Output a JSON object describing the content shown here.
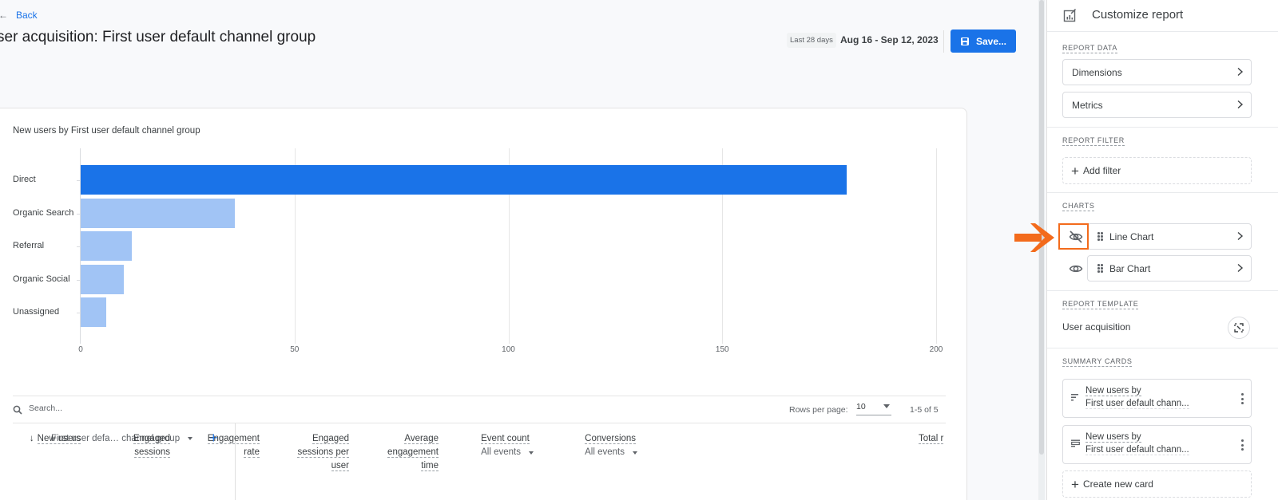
{
  "header": {
    "back_label": "Back",
    "title": "ser acquisition: First user default channel group",
    "date_chip": "Last 28 days",
    "date_range": "Aug 16 - Sep 12, 2023",
    "save_label": "Save..."
  },
  "chart_data": {
    "type": "bar",
    "orientation": "horizontal",
    "title": "New users by First user default channel group",
    "categories": [
      "Direct",
      "Organic Search",
      "Referral",
      "Organic Social",
      "Unassigned"
    ],
    "values": [
      179,
      36,
      12,
      10,
      6
    ],
    "highlighted_index": 0,
    "xlabel": "",
    "ylabel": "",
    "xlim": [
      0,
      200
    ],
    "xticks": [
      0,
      50,
      100,
      150,
      200
    ],
    "xtick_labels": [
      "0",
      "50",
      "100",
      "150",
      "200"
    ],
    "grid": true,
    "colors": {
      "highlight": "#1a73e8",
      "default": "#a1c4f5"
    }
  },
  "table": {
    "search_placeholder": "Search...",
    "rows_per_page_label": "Rows per page:",
    "rows_per_page_value": "10",
    "pager_text": "1-5 of 5",
    "dimension_header": "First user defa… channel group",
    "add_dimension": "+",
    "columns": [
      {
        "lines": [
          "New users"
        ],
        "sorted": true,
        "sort_icon": "arrow-down"
      },
      {
        "lines": [
          "Engaged",
          "sessions"
        ]
      },
      {
        "lines": [
          "Engagement",
          "rate"
        ]
      },
      {
        "lines": [
          "Engaged",
          "sessions per",
          "user"
        ]
      },
      {
        "lines": [
          "Average",
          "engagement",
          "time"
        ]
      },
      {
        "lines": [
          "Event count"
        ],
        "filter": "All events"
      },
      {
        "lines": [
          "Conversions"
        ],
        "filter": "All events"
      },
      {
        "lines": [
          "Total r"
        ]
      }
    ]
  },
  "panel": {
    "title": "Customize report",
    "title_icon": "report-edit-icon",
    "sections": {
      "report_data": {
        "label": "REPORT DATA",
        "items": [
          "Dimensions",
          "Metrics"
        ]
      },
      "report_filter": {
        "label": "REPORT FILTER",
        "add_label": "Add filter"
      },
      "charts": {
        "label": "CHARTS",
        "items": [
          {
            "label": "Line Chart",
            "visible": false,
            "visibility_icon": "eye-off-icon"
          },
          {
            "label": "Bar Chart",
            "visible": true,
            "visibility_icon": "eye-icon"
          }
        ]
      },
      "report_template": {
        "label": "REPORT TEMPLATE",
        "value": "User acquisition",
        "action_icon": "unlink-icon"
      },
      "summary_cards": {
        "label": "SUMMARY CARDS",
        "cards": [
          {
            "line1": "New users by",
            "line2": "First user default chann...",
            "icon": "bar-chart-horizontal-icon"
          },
          {
            "line1": "New users by",
            "line2": "First user default chann...",
            "icon": "table-chart-icon"
          }
        ],
        "create_label": "Create new card"
      }
    }
  },
  "annotation": {
    "color": "#f36b1c",
    "target": "line-chart-visibility-toggle"
  }
}
